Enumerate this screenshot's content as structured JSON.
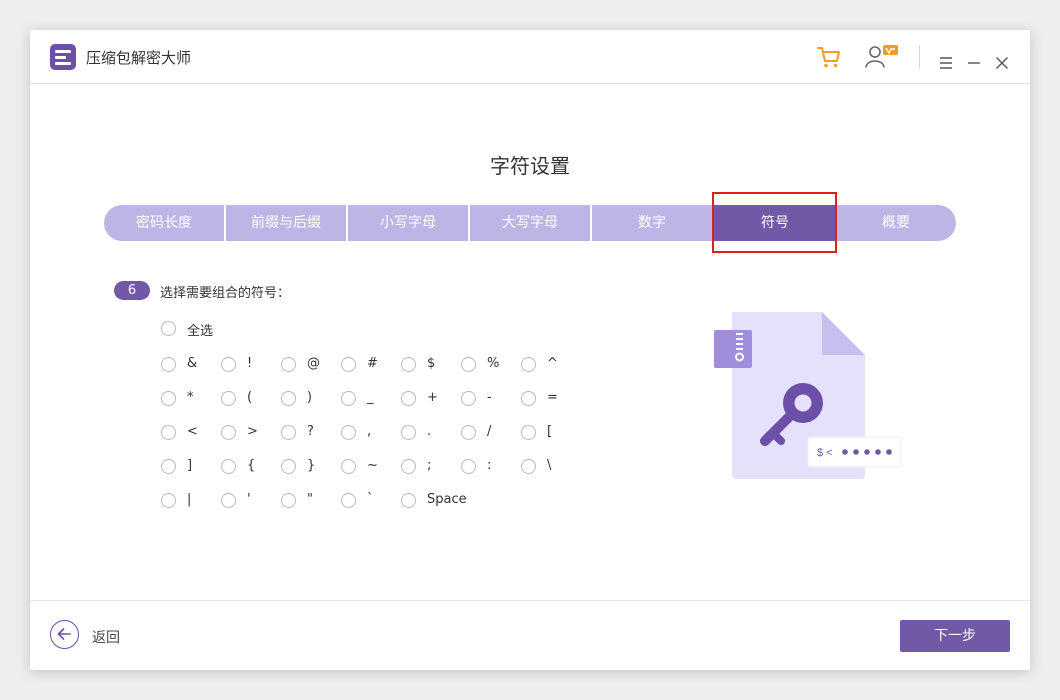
{
  "app": {
    "title": "压缩包解密大师"
  },
  "colors": {
    "accent": "#7159a8",
    "tab_inactive": "#bdb5e6",
    "highlight": "#e0201e",
    "cart": "#f39a2c"
  },
  "icons": {
    "logo": "archive-logo-icon",
    "cart": "cart-icon",
    "user": "user-vip-icon",
    "menu": "menu-icon",
    "minimize": "minimize-icon",
    "close": "close-icon"
  },
  "page": {
    "heading": "字符设置"
  },
  "tabs": [
    {
      "label": "密码长度"
    },
    {
      "label": "前缀与后缀"
    },
    {
      "label": "小写字母"
    },
    {
      "label": "大写字母"
    },
    {
      "label": "数字"
    },
    {
      "label": "符号",
      "active": true
    },
    {
      "label": "概要"
    }
  ],
  "step": {
    "number": "6",
    "label": "选择需要组合的符号："
  },
  "select_all": "全选",
  "symbols": [
    [
      "&",
      "!",
      "@",
      "#",
      "$",
      "%",
      "^"
    ],
    [
      "*",
      "(",
      ")",
      "_",
      "+",
      "-",
      "="
    ],
    [
      "<",
      ">",
      "?",
      ",",
      ".",
      "/",
      "["
    ],
    [
      "]",
      "{",
      "}",
      "~",
      ";",
      ":",
      "\\"
    ],
    [
      "|",
      "'",
      "\"",
      "`",
      "Space"
    ]
  ],
  "illustration": {
    "password_hint": "$ <"
  },
  "footer": {
    "back_label": "返回",
    "next_label": "下一步"
  }
}
